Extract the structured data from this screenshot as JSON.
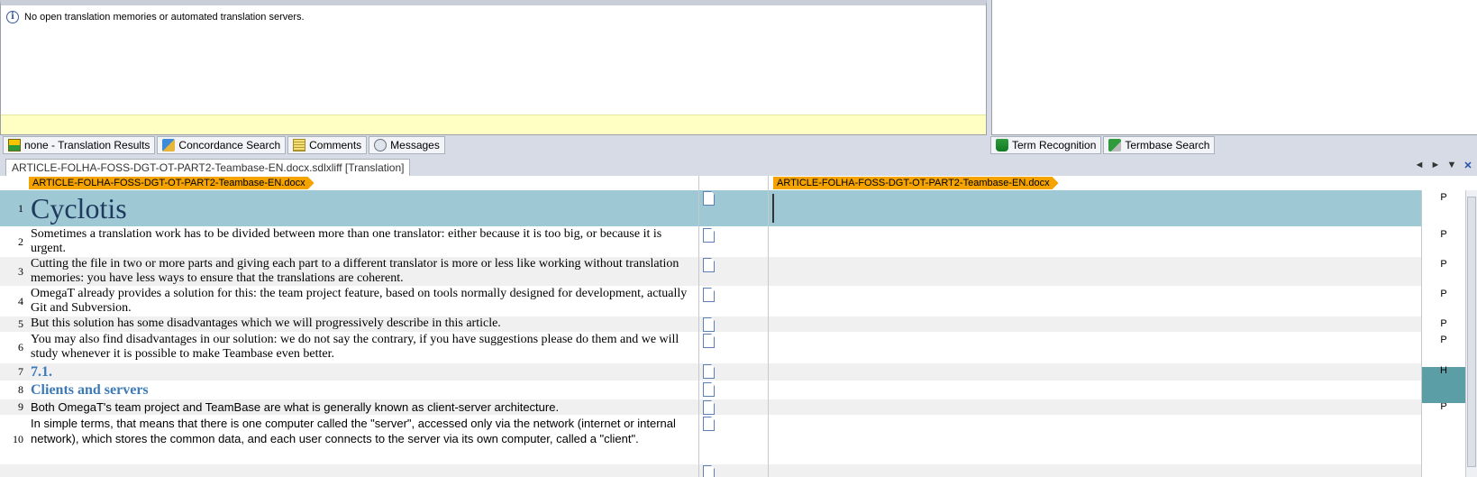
{
  "translation_results": {
    "message": "No open translation memories or automated translation servers."
  },
  "left_tabs": [
    {
      "label": "none - Translation Results",
      "icon": "translation-results-icon"
    },
    {
      "label": "Concordance Search",
      "icon": "concordance-search-icon"
    },
    {
      "label": "Comments",
      "icon": "comments-icon"
    },
    {
      "label": "Messages",
      "icon": "messages-icon"
    }
  ],
  "right_tabs": [
    {
      "label": "Term Recognition",
      "icon": "term-recognition-icon"
    },
    {
      "label": "Termbase Search",
      "icon": "termbase-search-icon"
    }
  ],
  "document_tab": {
    "label": "ARTICLE-FOLHA-FOSS-DGT-OT-PART2-Teambase-EN.docx.sdlxliff [Translation]"
  },
  "file_header": {
    "source_file": "ARTICLE-FOLHA-FOSS-DGT-OT-PART2-Teambase-EN.docx",
    "target_file": "ARTICLE-FOLHA-FOSS-DGT-OT-PART2-Teambase-EN.docx"
  },
  "segments": [
    {
      "num": "1",
      "text": "Cyclotis",
      "marker": "P"
    },
    {
      "num": "2",
      "text": "Sometimes a translation work has to be divided between more than one translator: either because it is too big, or because it is urgent.",
      "marker": "P"
    },
    {
      "num": "3",
      "text": "Cutting the file in two or more parts and giving each part to a different translator is more or less like working without translation memories: you have less ways to ensure that the translations are coherent.",
      "marker": "P"
    },
    {
      "num": "4",
      "text": "OmegaT already provides a solution for this: the team project feature, based on tools normally designed for development, actually Git and Subversion.",
      "marker": "P"
    },
    {
      "num": "5",
      "text": "But this solution has some disadvantages which we will progressively describe in this article.",
      "marker": "P"
    },
    {
      "num": "6",
      "text": "You may also find disadvantages in our solution: we do not say the contrary, if you have suggestions please do them and we will study whenever it is possible to make Teambase even better.",
      "marker": "P"
    },
    {
      "num": "7",
      "text": "7.1.",
      "marker": "H"
    },
    {
      "num": "8",
      "text": "Clients and servers",
      "marker": ""
    },
    {
      "num": "9",
      "text": "Both OmegaT's team project and TeamBase are what is generally known as client-server architecture.",
      "marker": "P"
    },
    {
      "num": "10",
      "text": "In simple terms, that means that there is one computer called the \"server\", accessed only via the network (internet or internal network), which stores the common data, and each user connects to the server via its own computer, called a \"client\".",
      "marker": ""
    }
  ],
  "nav": {
    "prev": "◄",
    "next": "►",
    "menu": "▼",
    "close": "✕"
  }
}
